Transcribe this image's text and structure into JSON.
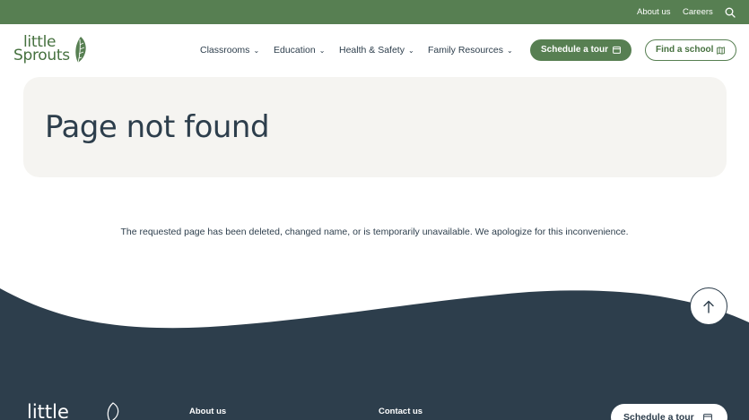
{
  "topbar": {
    "about_label": "About us",
    "careers_label": "Careers",
    "search_icon": "search-icon"
  },
  "header": {
    "logo_line1": "little",
    "logo_line2": "Sprouts",
    "nav": [
      {
        "label": "Classrooms"
      },
      {
        "label": "Education"
      },
      {
        "label": "Health & Safety"
      },
      {
        "label": "Family Resources"
      }
    ],
    "schedule_label": "Schedule a tour",
    "find_label": "Find a school"
  },
  "main": {
    "title": "Page not found",
    "message": "The requested page has been deleted, changed name, or is temporarily unavailable. We apologize for this inconvenience."
  },
  "footer": {
    "logo_text": "little",
    "about_label": "About us",
    "contact_label": "Contact us",
    "schedule_label": "Schedule a tour"
  },
  "colors": {
    "brand_green": "#577f52",
    "dark_navy": "#2d3e4c",
    "hero_bg": "#f5f4f1"
  }
}
